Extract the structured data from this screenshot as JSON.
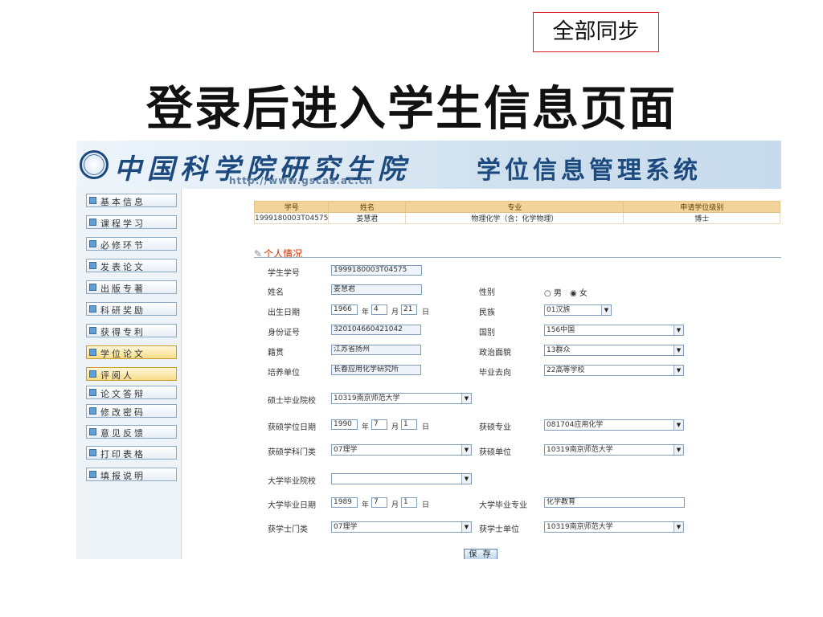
{
  "top_button": "全部同步",
  "slide_title": "登录后进入学生信息页面",
  "header": {
    "institution": "中国科学院研究生院",
    "url": "http://www.gscas.ac.cn",
    "system": "学位信息管理系统"
  },
  "sidebar": {
    "items": [
      "基本信息",
      "课程学习",
      "必修环节",
      "发表论文",
      "出版专著",
      "科研奖励",
      "获得专利",
      "学位论文",
      "评阅人",
      "论文答辩",
      "修改密码",
      "意见反馈",
      "打印表格",
      "填报说明"
    ],
    "active_index": 7
  },
  "summary": {
    "headers": [
      "学号",
      "姓名",
      "专业",
      "申请学位级别"
    ],
    "row": [
      "1999180003T04575",
      "姜慧君",
      "物理化学（含：化学物理）",
      "博士"
    ]
  },
  "section_title": "个人情况",
  "form": {
    "student_id_label": "学生学号",
    "student_id": "1999180003T04575",
    "name_label": "姓名",
    "name": "姜慧君",
    "gender_label": "性别",
    "gender_male": "男",
    "gender_female": "女",
    "gender_selected": "女",
    "birth_label": "出生日期",
    "birth_year": "1966",
    "birth_month": "4",
    "birth_day": "21",
    "unit_year": "年",
    "unit_month": "月",
    "unit_day": "日",
    "nation_label": "民族",
    "nation": "01汉族",
    "idcard_label": "身份证号",
    "idcard": "320104660421042",
    "country_label": "国别",
    "country": "156中国",
    "native_label": "籍贯",
    "native": "江苏省扬州",
    "political_label": "政治面貌",
    "political": "13群众",
    "train_unit_label": "培养单位",
    "train_unit": "长春应用化学研究所",
    "destination_label": "毕业去向",
    "destination": "22高等学校",
    "master_school_label": "硕士毕业院校",
    "master_school": "10319南京师范大学",
    "master_date_label": "获硕学位日期",
    "master_year": "1990",
    "master_month": "7",
    "master_day": "1",
    "master_major_label": "获硕专业",
    "master_major": "081704应用化学",
    "master_disc_label": "获硕学科门类",
    "master_disc": "07理学",
    "master_unit_label": "获硕单位",
    "master_unit": "10319南京师范大学",
    "bach_school_label": "大学毕业院校",
    "bach_school": "",
    "bach_date_label": "大学毕业日期",
    "bach_year": "1989",
    "bach_month": "7",
    "bach_day": "1",
    "bach_major_label": "大学毕业专业",
    "bach_major": "化学教育",
    "bach_disc_label": "获学士门类",
    "bach_disc": "07理学",
    "bach_unit_label": "获学士单位",
    "bach_unit": "10319南京师范大学",
    "save_label": "保 存"
  },
  "colors": {
    "table_header": "#f2d49a",
    "accent": "#1d4a7e",
    "section_title": "#cc3300"
  }
}
